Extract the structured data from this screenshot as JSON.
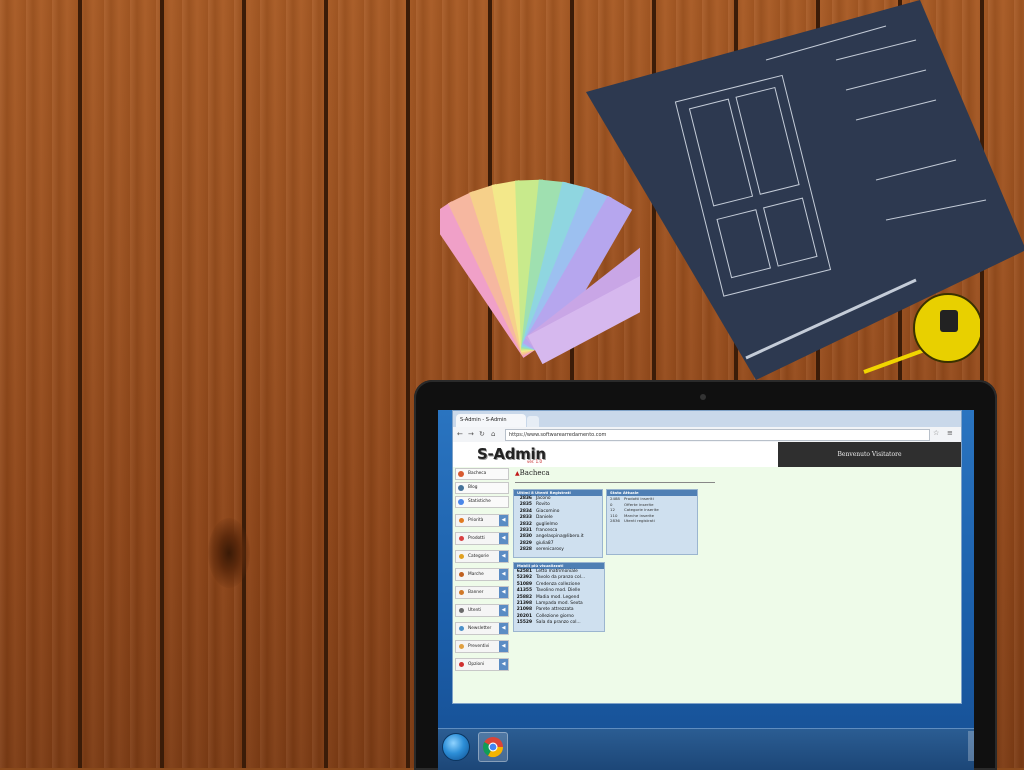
{
  "browser": {
    "tab_title": "S-Admin  -  S-Admin",
    "url": "https://www.softwarearredamento.com"
  },
  "app": {
    "logo": "S-Admin",
    "logo_version": "ver. 1.0",
    "welcome": "Benvenuto Visitatore",
    "section_title": "Bacheca"
  },
  "sidebar": {
    "top_items": [
      {
        "label": "Bacheca",
        "icon": "home-icon"
      },
      {
        "label": "Blog",
        "icon": "wordpress-icon"
      },
      {
        "label": "Statistiche",
        "icon": "google-icon"
      }
    ],
    "menu_items": [
      {
        "label": "Priorità",
        "icon": "priority-icon"
      },
      {
        "label": "Prodotti",
        "icon": "products-icon"
      },
      {
        "label": "Categorie",
        "icon": "categories-icon"
      },
      {
        "label": "Marche",
        "icon": "brands-icon"
      },
      {
        "label": "Banner",
        "icon": "banner-icon"
      },
      {
        "label": "Utenti",
        "icon": "users-icon"
      },
      {
        "label": "Newsletter",
        "icon": "newsletter-icon"
      },
      {
        "label": "Preventivi",
        "icon": "quotes-icon"
      },
      {
        "label": "Opzioni",
        "icon": "options-icon"
      }
    ]
  },
  "panels": {
    "recent_users": {
      "title": "Ultimi 8 Utenti Registrati",
      "rows": [
        {
          "id": "2836",
          "name": "Jacono"
        },
        {
          "id": "2835",
          "name": "Rovito"
        },
        {
          "id": "2834",
          "name": "Giacomino"
        },
        {
          "id": "2833",
          "name": "Daniele"
        },
        {
          "id": "2832",
          "name": "guglielmo"
        },
        {
          "id": "2831",
          "name": "francesca"
        },
        {
          "id": "2830",
          "name": "angelaspina@libero.it"
        },
        {
          "id": "2829",
          "name": "giulia87"
        },
        {
          "id": "2828",
          "name": "serenicarosy"
        }
      ]
    },
    "status": {
      "title": "Stato Attuale",
      "rows": [
        {
          "n": "2488",
          "label": "Prodotti inseriti"
        },
        {
          "n": "0",
          "label": "Offerte inserite"
        },
        {
          "n": "12",
          "label": "Categorie inserite"
        },
        {
          "n": "110",
          "label": "Marche inserite"
        },
        {
          "n": "2836",
          "label": "Utenti registrati"
        }
      ]
    },
    "most_viewed": {
      "title": "Mobili più visualizzati",
      "rows": [
        {
          "n": "62581",
          "label": "Letto matrimoniale"
        },
        {
          "n": "52392",
          "label": "Tavolo da pranzo col..."
        },
        {
          "n": "51089",
          "label": "Credenza collezione"
        },
        {
          "n": "41355",
          "label": "Tavolino mod. Dielle"
        },
        {
          "n": "25882",
          "label": "Madia mod. Legend"
        },
        {
          "n": "21398",
          "label": "Lampada mod. Sexta"
        },
        {
          "n": "21098",
          "label": "Parete attrezzata"
        },
        {
          "n": "20201",
          "label": "Collezione giorno"
        },
        {
          "n": "15529",
          "label": "Sala da pranzo col..."
        }
      ]
    }
  },
  "colors": {
    "page_bg": "#eefbe9",
    "panel_title": "#4f7fb4",
    "welcome_bg": "#2f2f2f",
    "desktop_blue": "#1d5fa8"
  }
}
